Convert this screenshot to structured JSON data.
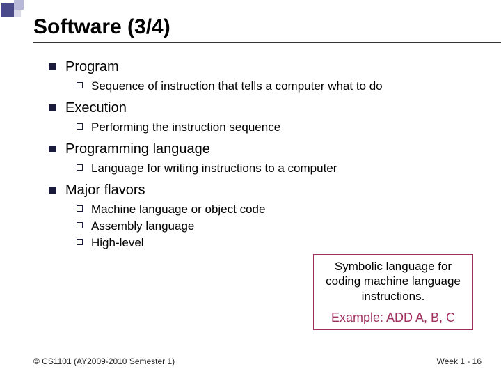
{
  "title": "Software (3/4)",
  "items": [
    {
      "label": "Program",
      "sub": [
        {
          "text": "Sequence of instruction that tells a computer what to do"
        }
      ]
    },
    {
      "label": "Execution",
      "sub": [
        {
          "text": "Performing the instruction sequence"
        }
      ]
    },
    {
      "label": "Programming language",
      "sub": [
        {
          "text": "Language for writing instructions to a computer"
        }
      ]
    },
    {
      "label": "Major flavors",
      "sub": [
        {
          "text": "Machine language or object code"
        },
        {
          "text": "Assembly language"
        },
        {
          "text": "High-level"
        }
      ]
    }
  ],
  "callout": {
    "desc": "Symbolic language for coding machine language instructions.",
    "example": "Example: ADD A, B, C"
  },
  "footer": {
    "left": "© CS1101 (AY2009-2010 Semester 1)",
    "right": "Week 1 - 16"
  }
}
